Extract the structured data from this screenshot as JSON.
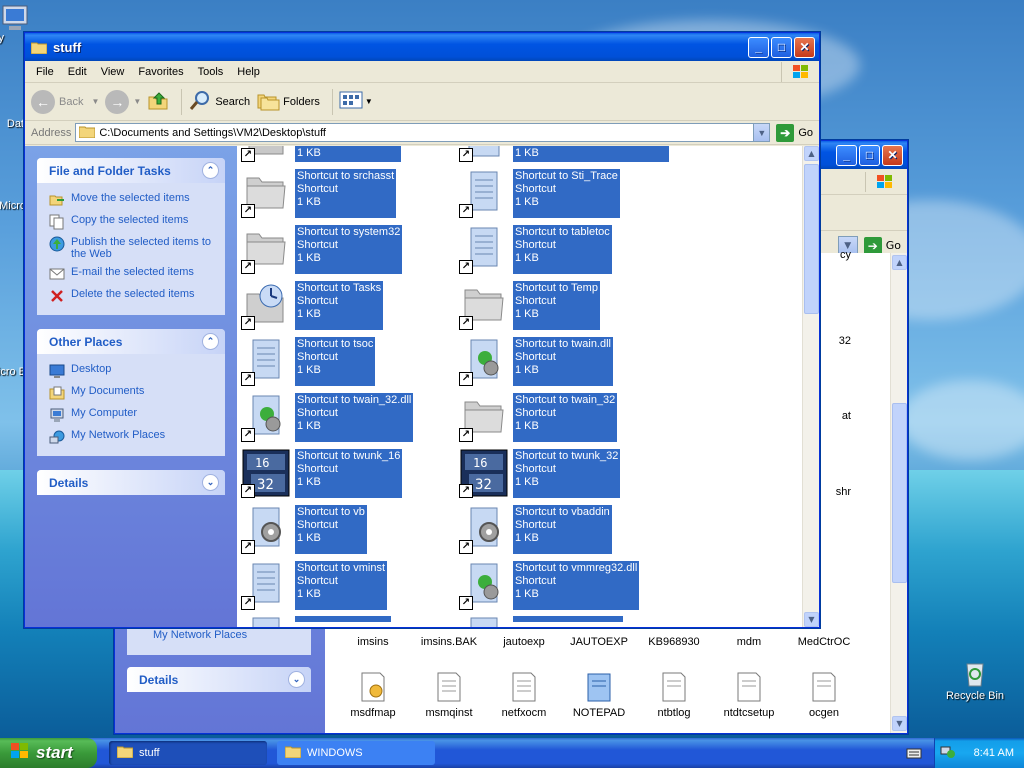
{
  "desktop": {
    "icons": [
      {
        "label": "My"
      },
      {
        "label": "Dat"
      },
      {
        "label": "Micro"
      },
      {
        "label": "Micro B"
      },
      {
        "label": "Recycle Bin"
      }
    ]
  },
  "front_window": {
    "title": "stuff",
    "menu": [
      "File",
      "Edit",
      "View",
      "Favorites",
      "Tools",
      "Help"
    ],
    "toolbar": {
      "back": "Back",
      "search": "Search",
      "folders": "Folders"
    },
    "address": {
      "label": "Address",
      "value": "C:\\Documents and Settings\\VM2\\Desktop\\stuff",
      "go": "Go"
    },
    "tasks": {
      "title": "File and Folder Tasks",
      "items": [
        "Move the selected items",
        "Copy the selected items",
        "Publish the selected items to the Web",
        "E-mail the selected items",
        "Delete the selected items"
      ]
    },
    "other_places": {
      "title": "Other Places",
      "items": [
        "Desktop",
        "My Documents",
        "My Computer",
        "My Network Places"
      ]
    },
    "details": {
      "title": "Details"
    },
    "files": [
      {
        "name": "Shortcut to srchasst",
        "type": "Shortcut",
        "size": "1 KB",
        "icon": "folder"
      },
      {
        "name": "Shortcut to Sti_Trace",
        "type": "Shortcut",
        "size": "1 KB",
        "icon": "notepad"
      },
      {
        "name": "Shortcut to system32",
        "type": "Shortcut",
        "size": "1 KB",
        "icon": "folder"
      },
      {
        "name": "Shortcut to tabletoc",
        "type": "Shortcut",
        "size": "1 KB",
        "icon": "notepad"
      },
      {
        "name": "Shortcut to Tasks",
        "type": "Shortcut",
        "size": "1 KB",
        "icon": "tasks"
      },
      {
        "name": "Shortcut to Temp",
        "type": "Shortcut",
        "size": "1 KB",
        "icon": "folder"
      },
      {
        "name": "Shortcut to tsoc",
        "type": "Shortcut",
        "size": "1 KB",
        "icon": "notepad"
      },
      {
        "name": "Shortcut to twain.dll",
        "type": "Shortcut",
        "size": "1 KB",
        "icon": "dll"
      },
      {
        "name": "Shortcut to twain_32.dll",
        "type": "Shortcut",
        "size": "1 KB",
        "icon": "dll"
      },
      {
        "name": "Shortcut to twain_32",
        "type": "Shortcut",
        "size": "1 KB",
        "icon": "folder"
      },
      {
        "name": "Shortcut to twunk_16",
        "type": "Shortcut",
        "size": "1 KB",
        "icon": "1632"
      },
      {
        "name": "Shortcut to twunk_32",
        "type": "Shortcut",
        "size": "1 KB",
        "icon": "1632"
      },
      {
        "name": "Shortcut to vb",
        "type": "Shortcut",
        "size": "1 KB",
        "icon": "gear"
      },
      {
        "name": "Shortcut to vbaddin",
        "type": "Shortcut",
        "size": "1 KB",
        "icon": "gear"
      },
      {
        "name": "Shortcut to vminst",
        "type": "Shortcut",
        "size": "1 KB",
        "icon": "notepad"
      },
      {
        "name": "Shortcut to vmmreg32.dll",
        "type": "Shortcut",
        "size": "1 KB",
        "icon": "dll"
      }
    ],
    "top_partial_sizes": [
      "1 KB",
      "1 KB"
    ]
  },
  "back_window": {
    "title": "WINDOWS",
    "address_go": "Go",
    "other_places_visible": "My Network Places",
    "details": {
      "title": "Details"
    },
    "right_partial": [
      "cy",
      "32",
      "at",
      "shr"
    ],
    "row1": [
      "imsins",
      "imsins.BAK",
      "jautoexp",
      "JAUTOEXP",
      "KB968930",
      "mdm",
      "MedCtrOC"
    ],
    "row2": [
      "msdfmap",
      "msmqinst",
      "netfxocm",
      "NOTEPAD",
      "ntbtlog",
      "ntdtcsetup",
      "ocgen"
    ]
  },
  "taskbar": {
    "start": "start",
    "tasks": [
      "stuff",
      "WINDOWS"
    ],
    "clock": "8:41 AM"
  },
  "colors": {
    "selection": "#316ac5",
    "link": "#215dc6",
    "titlebar": "#0054e3"
  }
}
